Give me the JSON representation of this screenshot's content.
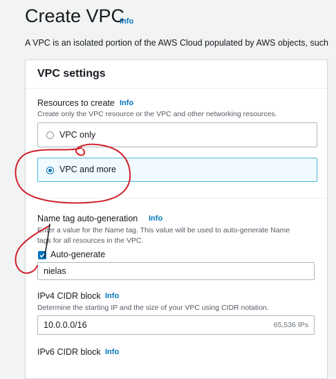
{
  "page": {
    "title": "Create VPC",
    "title_info": "Info",
    "description": "A VPC is an isolated portion of the AWS Cloud populated by AWS objects, such"
  },
  "settings": {
    "card_title": "VPC settings",
    "resources": {
      "label": "Resources to create",
      "info": "Info",
      "description": "Create only the VPC resource or the VPC and other networking resources.",
      "options": [
        {
          "label": "VPC only",
          "selected": false
        },
        {
          "label": "VPC and more",
          "selected": true
        }
      ]
    },
    "name_tag": {
      "label": "Name tag auto-generation",
      "info": "Info",
      "description_line1": "Enter a value for the Name tag. This value will be used to auto-generate Name",
      "description_line2": "tags for all resources in the VPC.",
      "checkbox_label": "Auto-generate",
      "checked": true,
      "value": "nielas"
    },
    "ipv4": {
      "label": "IPv4 CIDR block",
      "info": "Info",
      "description": "Determine the starting IP and the size of your VPC using CIDR notation.",
      "value": "10.0.0.0/16",
      "ip_count": "65,536 IPs"
    },
    "ipv6": {
      "label": "IPv6 CIDR block",
      "info": "Info"
    }
  },
  "colors": {
    "accent": "#0073bb",
    "selected_border": "#44b9d6",
    "annotation_red": "#d0202a"
  }
}
